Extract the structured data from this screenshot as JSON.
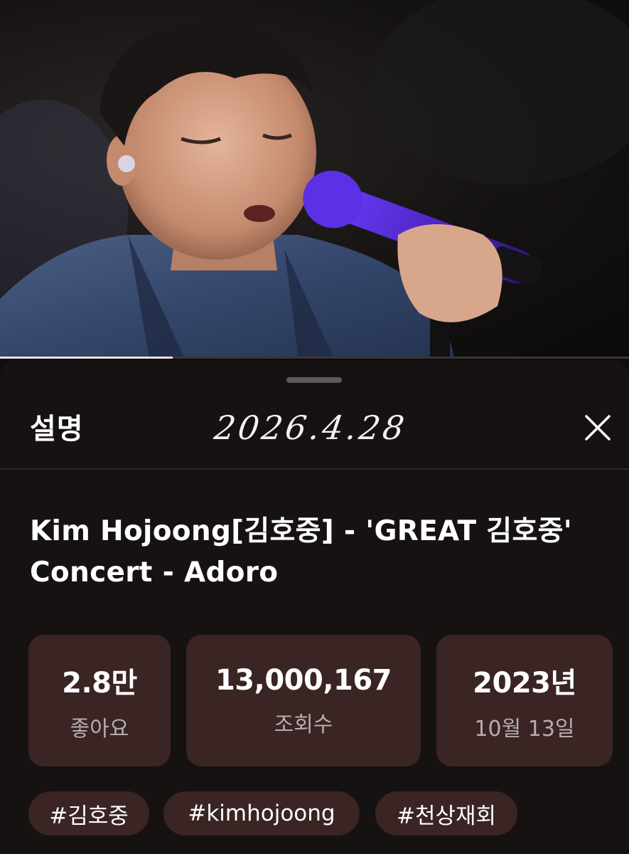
{
  "video": {
    "progress_fraction": 0.275
  },
  "sheet": {
    "title": "설명",
    "handwritten_note": "2026.4.28",
    "close_icon": "close-icon"
  },
  "description": {
    "video_title": "Kim Hojoong[김호중] - 'GREAT 김호중' Concert - Adoro",
    "stats": [
      {
        "value": "2.8만",
        "label": "좋아요"
      },
      {
        "value": "13,000,167",
        "label": "조회수"
      },
      {
        "value": "2023년",
        "label": "10월 13일"
      }
    ],
    "hashtags": [
      "#김호중",
      "#kimhojoong",
      "#천상재회"
    ]
  },
  "colors": {
    "background": "#171212",
    "card": "#3a2424",
    "microphone": "#5a2fd0"
  }
}
